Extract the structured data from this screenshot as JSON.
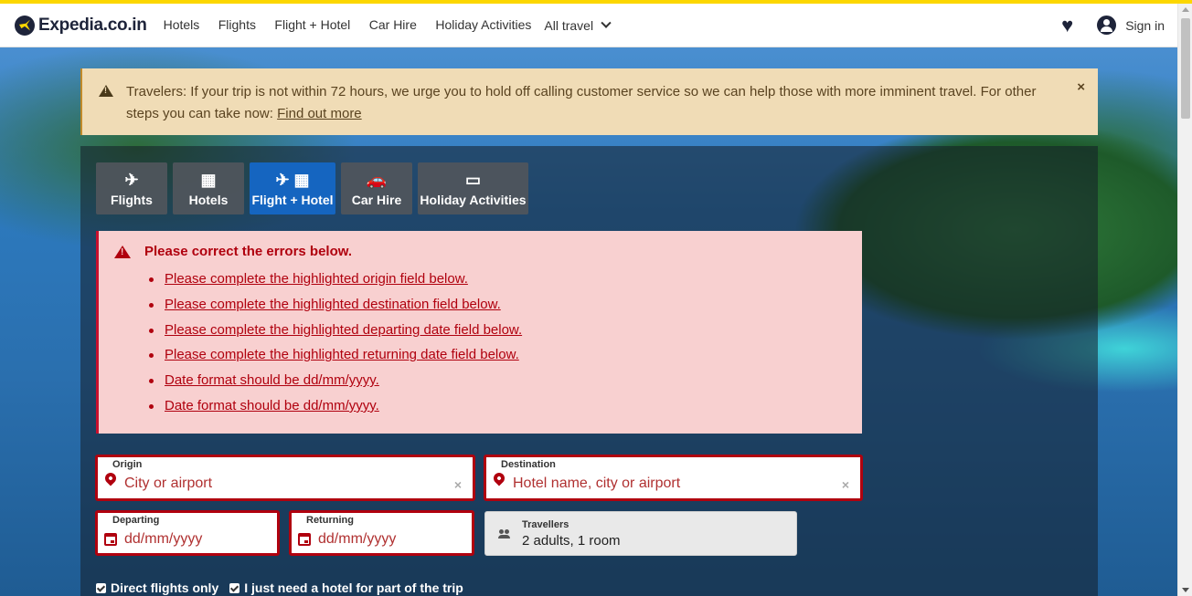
{
  "header": {
    "logo_text": "Expedia.co.in",
    "nav": [
      "Hotels",
      "Flights",
      "Flight + Hotel",
      "Car Hire",
      "Holiday Activities"
    ],
    "all_travel": "All travel",
    "signin": "Sign in"
  },
  "alert": {
    "text": "Travelers: If your trip is not within 72 hours, we urge you to hold off calling customer service so we can help those with more imminent travel. For other steps you can take now: ",
    "link": "Find out more",
    "close": "×"
  },
  "tabs": [
    {
      "label": "Flights",
      "icon": "plane-icon",
      "glyph": "✈"
    },
    {
      "label": "Hotels",
      "icon": "hotel-icon",
      "glyph": "▦"
    },
    {
      "label": "Flight + Hotel",
      "icon": "plane-hotel-icon",
      "glyph": "✈ ▦"
    },
    {
      "label": "Car Hire",
      "icon": "car-icon",
      "glyph": "🚗"
    },
    {
      "label": "Holiday Activities",
      "icon": "ticket-icon",
      "glyph": "▭"
    }
  ],
  "errors": {
    "title": "Please correct the errors below.",
    "items": [
      "Please complete the highlighted origin field below.",
      "Please complete the highlighted destination field below.",
      "Please complete the highlighted departing date field below.",
      "Please complete the highlighted returning date field below.",
      "Date format should be dd/mm/yyyy.",
      "Date format should be dd/mm/yyyy."
    ]
  },
  "form": {
    "origin": {
      "label": "Origin",
      "placeholder": "City or airport"
    },
    "destination": {
      "label": "Destination",
      "placeholder": "Hotel name, city or airport"
    },
    "departing": {
      "label": "Departing",
      "placeholder": "dd/mm/yyyy"
    },
    "returning": {
      "label": "Returning",
      "placeholder": "dd/mm/yyyy"
    },
    "travellers": {
      "label": "Travellers",
      "value": "2 adults, 1 room"
    },
    "checks": [
      "Direct flights only",
      "I just need a hotel for part of the trip"
    ]
  },
  "colors": {
    "brand_yellow": "#fcd700",
    "active_tab": "#1565c0",
    "error": "#b0000e"
  }
}
